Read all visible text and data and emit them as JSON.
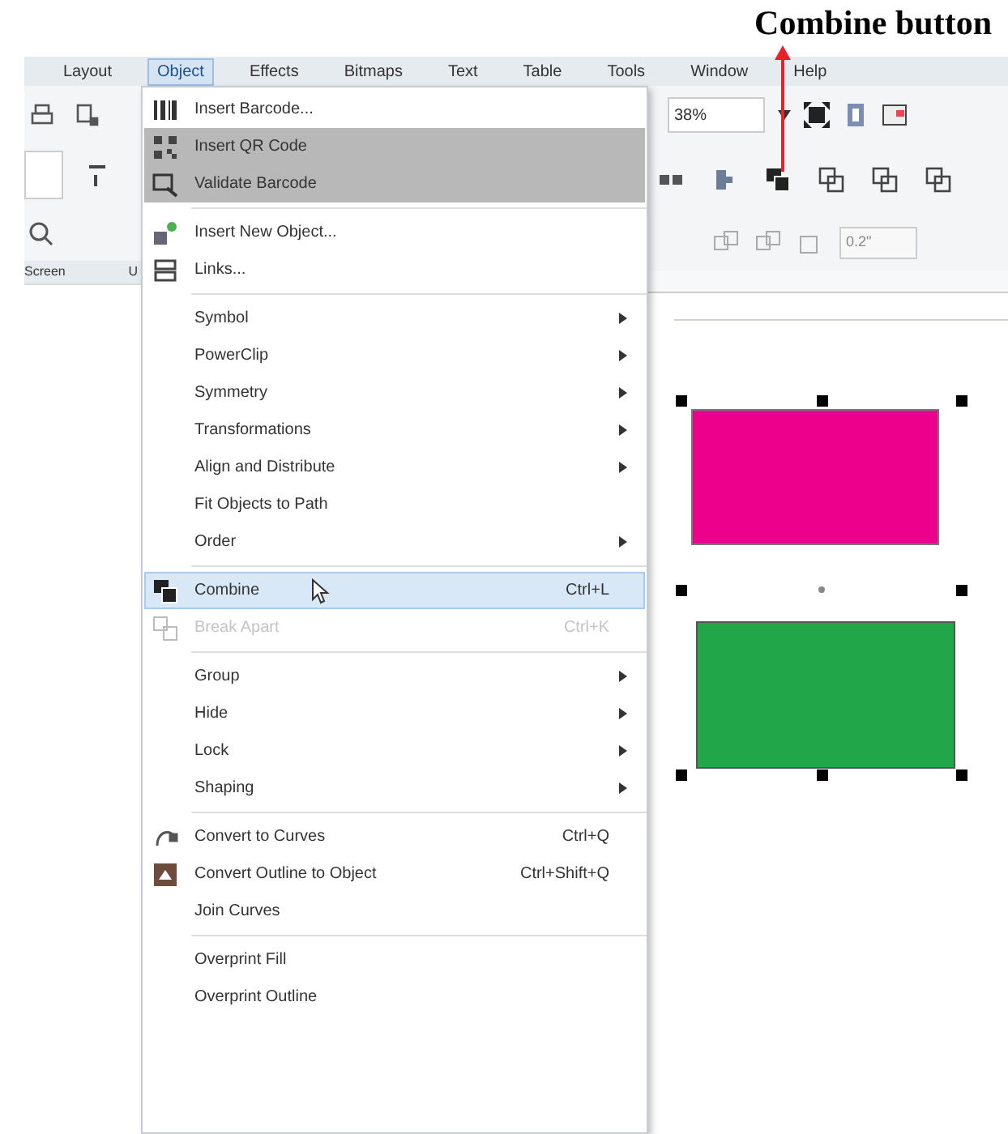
{
  "annotation": {
    "label": "Combine button"
  },
  "menubar": [
    {
      "label": "Layout",
      "selected": false
    },
    {
      "label": "Object",
      "selected": true
    },
    {
      "label": "Effects",
      "selected": false
    },
    {
      "label": "Bitmaps",
      "selected": false
    },
    {
      "label": "Text",
      "selected": false
    },
    {
      "label": "Table",
      "selected": false
    },
    {
      "label": "Tools",
      "selected": false
    },
    {
      "label": "Window",
      "selected": false
    },
    {
      "label": "Help",
      "selected": false
    }
  ],
  "left_toolbar": {
    "tabs": [
      "Screen",
      "U"
    ]
  },
  "menu": {
    "items": [
      {
        "kind": "item",
        "label": "Insert Barcode...",
        "submenu": false,
        "shaded": false,
        "selected": false,
        "disabled": false
      },
      {
        "kind": "item",
        "label": "Insert QR Code",
        "submenu": false,
        "shaded": true,
        "selected": false,
        "disabled": false
      },
      {
        "kind": "item",
        "label": "Validate Barcode",
        "submenu": false,
        "shaded": true,
        "selected": false,
        "disabled": false
      },
      {
        "kind": "separator"
      },
      {
        "kind": "item",
        "label": "Insert New Object...",
        "submenu": false,
        "shaded": false,
        "selected": false,
        "disabled": false
      },
      {
        "kind": "item",
        "label": "Links...",
        "submenu": false,
        "shaded": false,
        "selected": false,
        "disabled": false
      },
      {
        "kind": "separator"
      },
      {
        "kind": "item",
        "label": "Symbol",
        "submenu": true,
        "shaded": false,
        "selected": false,
        "disabled": false
      },
      {
        "kind": "item",
        "label": "PowerClip",
        "submenu": true,
        "shaded": false,
        "selected": false,
        "disabled": false
      },
      {
        "kind": "item",
        "label": "Symmetry",
        "submenu": true,
        "shaded": false,
        "selected": false,
        "disabled": false
      },
      {
        "kind": "item",
        "label": "Transformations",
        "submenu": true,
        "shaded": false,
        "selected": false,
        "disabled": false
      },
      {
        "kind": "item",
        "label": "Align and Distribute",
        "submenu": true,
        "shaded": false,
        "selected": false,
        "disabled": false
      },
      {
        "kind": "item",
        "label": "Fit Objects to Path",
        "submenu": false,
        "shaded": false,
        "selected": false,
        "disabled": false
      },
      {
        "kind": "item",
        "label": "Order",
        "submenu": true,
        "shaded": false,
        "selected": false,
        "disabled": false
      },
      {
        "kind": "separator"
      },
      {
        "kind": "item",
        "label": "Combine",
        "shortcut": "Ctrl+L",
        "submenu": false,
        "shaded": false,
        "selected": true,
        "disabled": false
      },
      {
        "kind": "item",
        "label": "Break Apart",
        "shortcut": "Ctrl+K",
        "submenu": false,
        "shaded": false,
        "selected": false,
        "disabled": true
      },
      {
        "kind": "separator"
      },
      {
        "kind": "item",
        "label": "Group",
        "submenu": true,
        "shaded": false,
        "selected": false,
        "disabled": false
      },
      {
        "kind": "item",
        "label": "Hide",
        "submenu": true,
        "shaded": false,
        "selected": false,
        "disabled": false
      },
      {
        "kind": "item",
        "label": "Lock",
        "submenu": true,
        "shaded": false,
        "selected": false,
        "disabled": false
      },
      {
        "kind": "item",
        "label": "Shaping",
        "submenu": true,
        "shaded": false,
        "selected": false,
        "disabled": false
      },
      {
        "kind": "separator"
      },
      {
        "kind": "item",
        "label": "Convert to Curves",
        "shortcut": "Ctrl+Q",
        "submenu": false,
        "shaded": false,
        "selected": false,
        "disabled": false
      },
      {
        "kind": "item",
        "label": "Convert Outline to Object",
        "shortcut": "Ctrl+Shift+Q",
        "submenu": false,
        "shaded": false,
        "selected": false,
        "disabled": false
      },
      {
        "kind": "item",
        "label": "Join Curves",
        "submenu": false,
        "shaded": false,
        "selected": false,
        "disabled": false
      },
      {
        "kind": "separator"
      },
      {
        "kind": "item",
        "label": "Overprint Fill",
        "submenu": false,
        "shaded": false,
        "selected": false,
        "disabled": false
      },
      {
        "kind": "item",
        "label": "Overprint Outline",
        "submenu": false,
        "shaded": false,
        "selected": false,
        "disabled": false
      }
    ]
  },
  "toolbar": {
    "zoom": "38%",
    "outline_width": "0.2\""
  }
}
